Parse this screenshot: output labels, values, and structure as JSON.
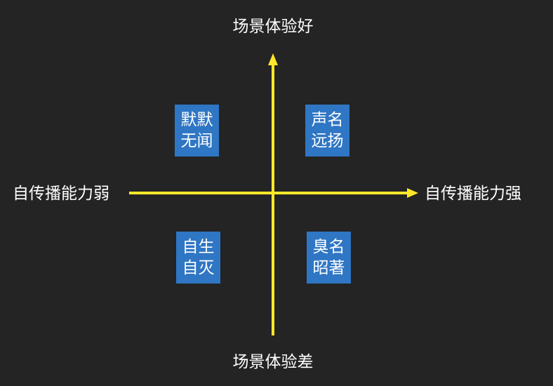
{
  "axes": {
    "top": "场景体验好",
    "bottom": "场景体验差",
    "left": "自传播能力弱",
    "right": "自传播能力强",
    "color": "#ffe82a"
  },
  "quadrants": {
    "top_left": {
      "line1": "默默",
      "line2": "无闻"
    },
    "top_right": {
      "line1": "声名",
      "line2": "远扬"
    },
    "bottom_left": {
      "line1": "自生",
      "line2": "自灭"
    },
    "bottom_right": {
      "line1": "臭名",
      "line2": "昭著"
    },
    "fill_color": "#2f76c4"
  },
  "background_color": "#242424"
}
